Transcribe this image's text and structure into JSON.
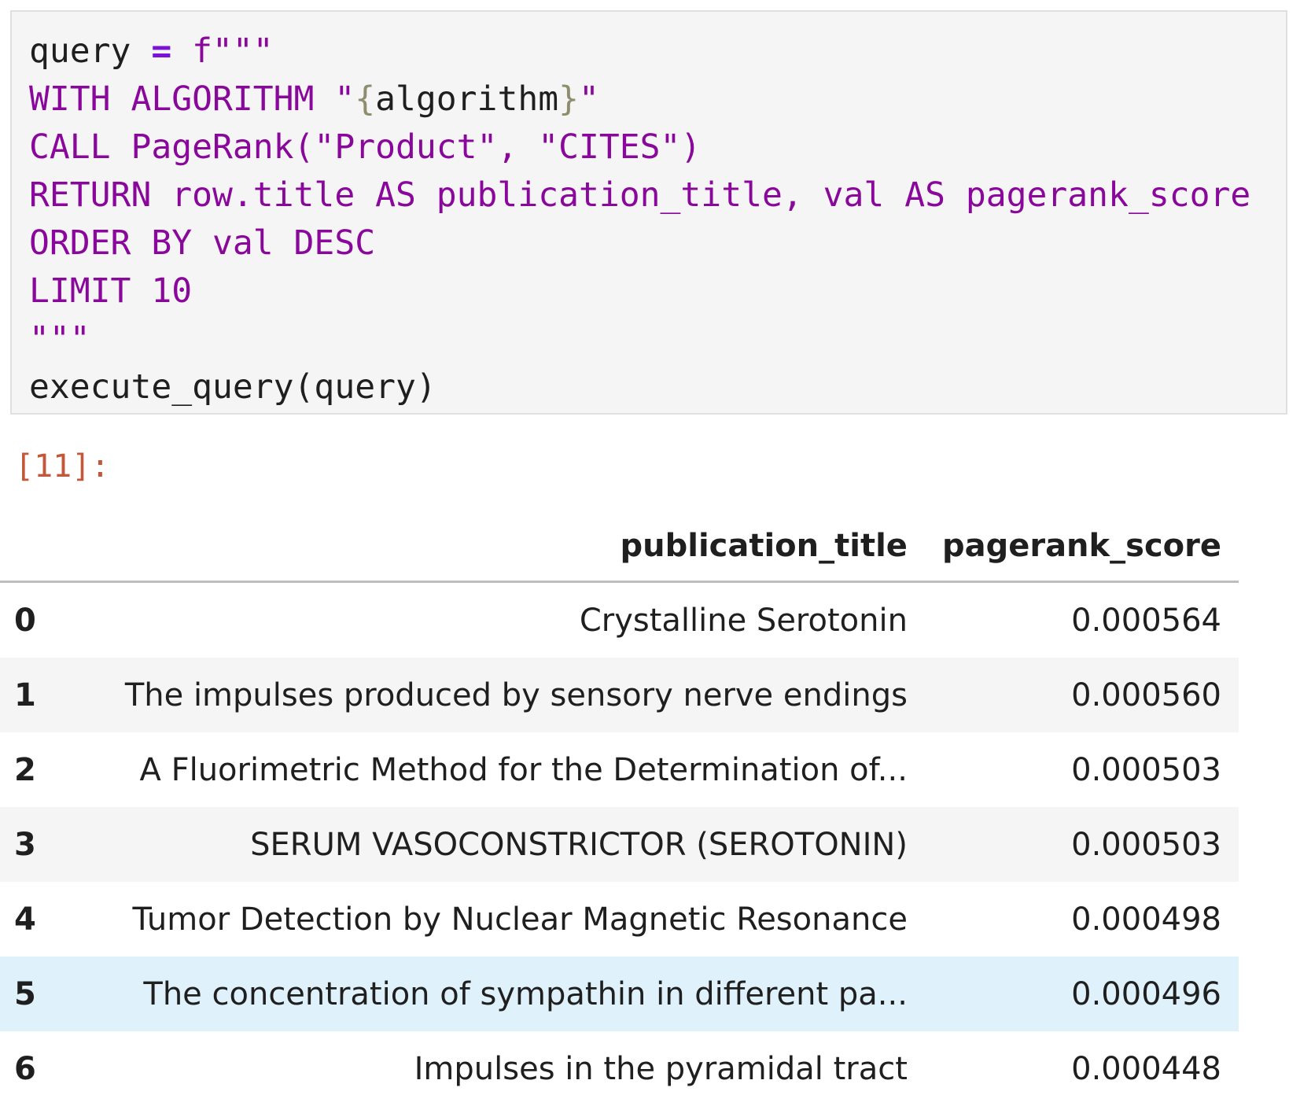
{
  "code_cell": {
    "lines": [
      [
        {
          "t": "query ",
          "c": ""
        },
        {
          "t": "=",
          "c": "op"
        },
        {
          "t": " f\"\"\"",
          "c": "str"
        }
      ],
      [
        {
          "t": "WITH ALGORITHM \"",
          "c": "str"
        },
        {
          "t": "{",
          "c": "brace"
        },
        {
          "t": "algorithm",
          "c": ""
        },
        {
          "t": "}",
          "c": "brace"
        },
        {
          "t": "\"",
          "c": "str"
        }
      ],
      [
        {
          "t": "CALL PageRank(\"Product\", \"CITES\")",
          "c": "str"
        }
      ],
      [
        {
          "t": "RETURN row.title AS publication_title, val AS pagerank_score",
          "c": "str"
        }
      ],
      [
        {
          "t": "ORDER BY val DESC",
          "c": "str"
        }
      ],
      [
        {
          "t": "LIMIT 10",
          "c": "str"
        }
      ],
      [
        {
          "t": "\"\"\"",
          "c": "str"
        }
      ],
      [
        {
          "t": "execute_query(query)",
          "c": ""
        }
      ]
    ]
  },
  "output_prompt": "[11]:",
  "table": {
    "columns": [
      "",
      "publication_title",
      "pagerank_score"
    ],
    "rows": [
      {
        "index": "0",
        "publication_title": "Crystalline Serotonin",
        "pagerank_score": "0.000564"
      },
      {
        "index": "1",
        "publication_title": "The impulses produced by sensory nerve endings",
        "pagerank_score": "0.000560"
      },
      {
        "index": "2",
        "publication_title": "A Fluorimetric Method for the Determination of...",
        "pagerank_score": "0.000503"
      },
      {
        "index": "3",
        "publication_title": "SERUM VASOCONSTRICTOR (SEROTONIN)",
        "pagerank_score": "0.000503"
      },
      {
        "index": "4",
        "publication_title": "Tumor Detection by Nuclear Magnetic Resonance",
        "pagerank_score": "0.000498"
      },
      {
        "index": "5",
        "publication_title": "The concentration of sympathin in different pa...",
        "pagerank_score": "0.000496"
      },
      {
        "index": "6",
        "publication_title": "Impulses in the pyramidal tract",
        "pagerank_score": "0.000448"
      }
    ],
    "hovered_row": "5"
  },
  "colors": {
    "string": "#8a079b",
    "operator": "#7c11d8",
    "prompt": "#c2573a",
    "striped_row": "#f5f5f5",
    "hover_row": "#dff2fb"
  }
}
